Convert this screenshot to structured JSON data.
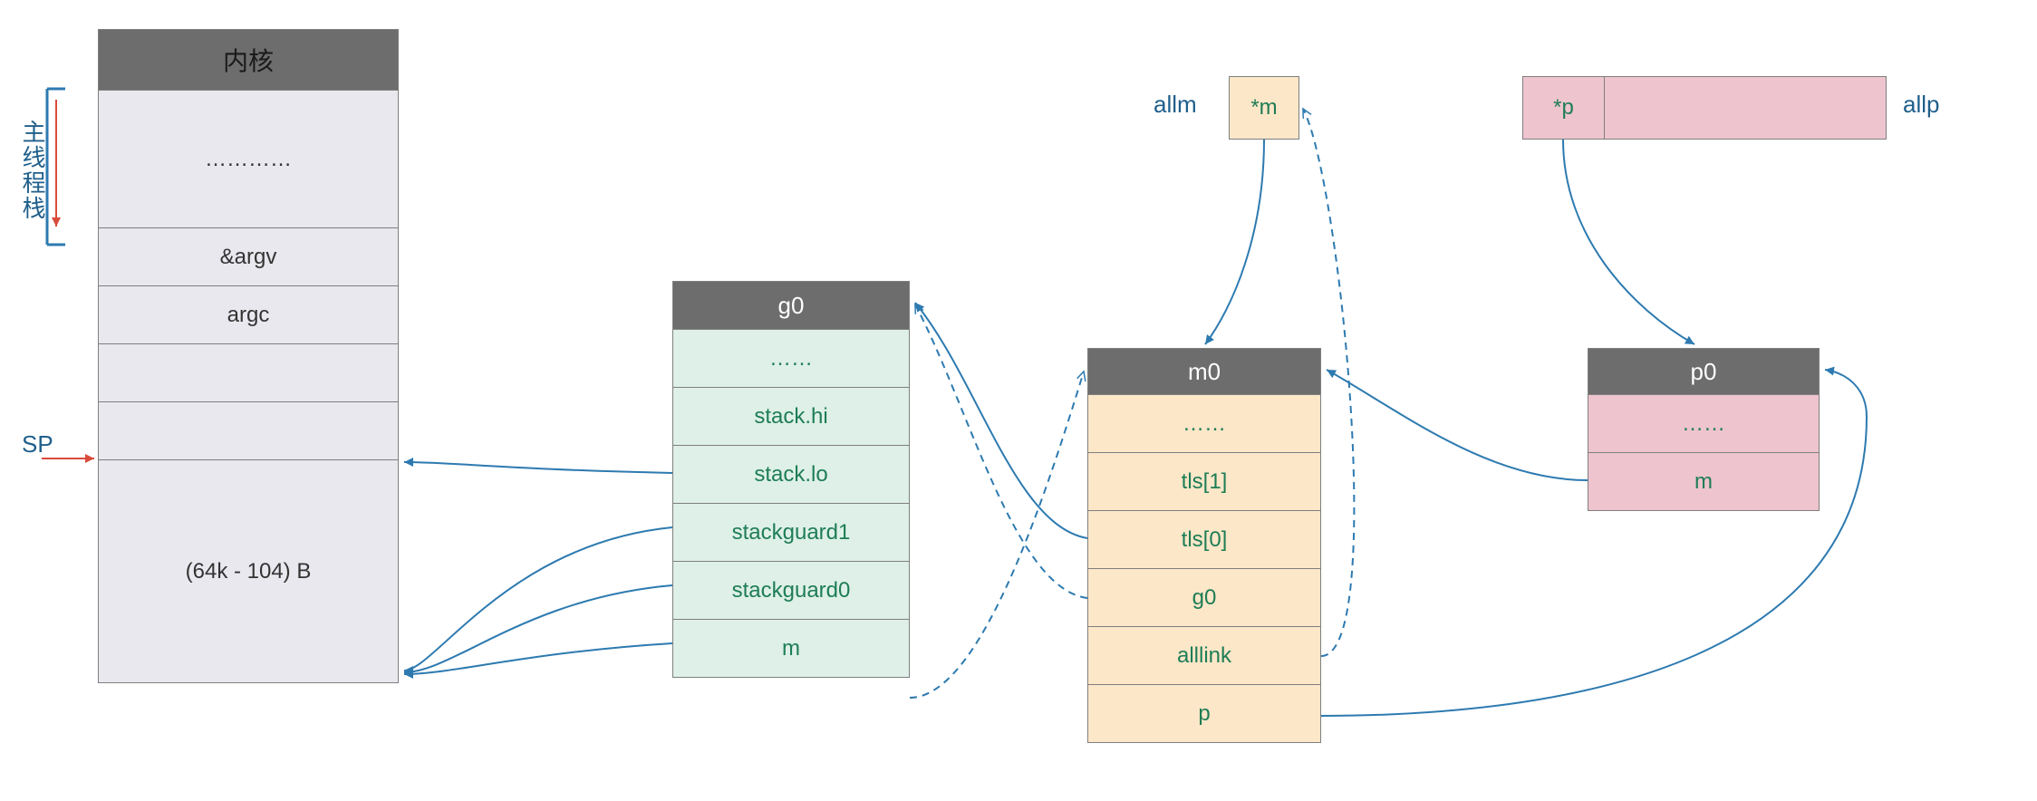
{
  "stack": {
    "header": "内核",
    "rows": [
      "…………",
      "&argv",
      "argc",
      ""
    ],
    "bottom": "(64k - 104) B",
    "sidelabel": "主线程栈",
    "sp": "SP"
  },
  "g0": {
    "header": "g0",
    "rows": [
      "……",
      "stack.hi",
      "stack.lo",
      "stackguard1",
      "stackguard0",
      "m"
    ]
  },
  "m0": {
    "header": "m0",
    "rows": [
      "……",
      "tls[1]",
      "tls[0]",
      "g0",
      "alllink",
      "p"
    ]
  },
  "p0": {
    "header": "p0",
    "rows": [
      "……",
      "m"
    ]
  },
  "allm": {
    "label": "allm",
    "cell": "*m"
  },
  "allp": {
    "label": "allp",
    "cell": "*p"
  },
  "colors": {
    "arrow": "#2d7ab0",
    "arrow_red": "#d94b3a"
  }
}
